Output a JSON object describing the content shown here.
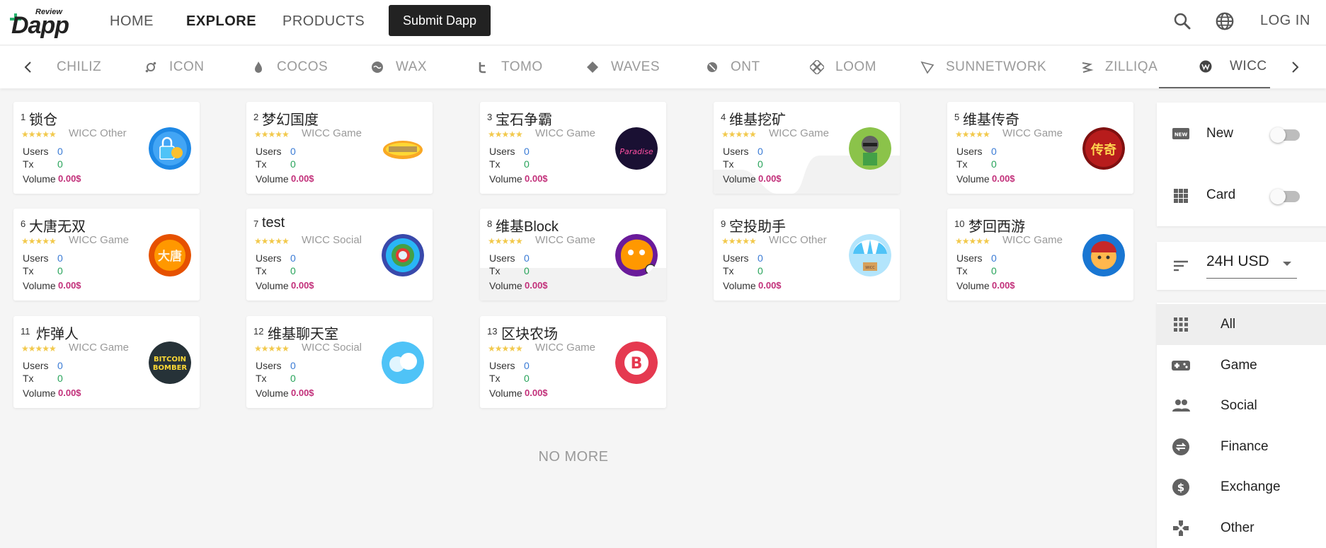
{
  "header": {
    "logo_review": "Review",
    "logo_dapp": "Dapp",
    "nav": [
      "HOME",
      "EXPLORE",
      "PRODUCTS"
    ],
    "submit_label": "Submit Dapp",
    "login_label": "LOG IN"
  },
  "chains": {
    "items": [
      {
        "label": "CHILIZ",
        "icon": "none"
      },
      {
        "label": "ICON",
        "icon": "icon-chain-icon"
      },
      {
        "label": "COCOS",
        "icon": "cocos-flame-icon"
      },
      {
        "label": "WAX",
        "icon": "wax-icon"
      },
      {
        "label": "TOMO",
        "icon": "tomo-icon"
      },
      {
        "label": "WAVES",
        "icon": "waves-diamond-icon"
      },
      {
        "label": "ONT",
        "icon": "ont-icon"
      },
      {
        "label": "LOOM",
        "icon": "loom-icon"
      },
      {
        "label": "SUNNETWORK",
        "icon": "sunnetwork-icon"
      },
      {
        "label": "ZILLIQA",
        "icon": "zilliqa-icon"
      },
      {
        "label": "WICC",
        "icon": "wicc-icon"
      }
    ],
    "active": "WICC"
  },
  "labels": {
    "users": "Users",
    "tx": "Tx",
    "volume": "Volume",
    "stars": "★★★★★"
  },
  "dapps": [
    {
      "rank": "1",
      "name": "锁仓",
      "category": "WICC Other",
      "users": "0",
      "tx": "0",
      "volume": "0.00$",
      "logo": "lock-logo"
    },
    {
      "rank": "2",
      "name": "梦幻国度",
      "category": "WICC Game",
      "users": "0",
      "tx": "0",
      "volume": "0.00$",
      "logo": "dream-kingdom-logo"
    },
    {
      "rank": "3",
      "name": "宝石争霸",
      "category": "WICC Game",
      "users": "0",
      "tx": "0",
      "volume": "0.00$",
      "logo": "gem-paradise-logo"
    },
    {
      "rank": "4",
      "name": "维基挖矿",
      "category": "WICC Game",
      "users": "0",
      "tx": "0",
      "volume": "0.00$",
      "logo": "mining-logo"
    },
    {
      "rank": "5",
      "name": "维基传奇",
      "category": "WICC Game",
      "users": "0",
      "tx": "0",
      "volume": "0.00$",
      "logo": "legend-logo"
    },
    {
      "rank": "6",
      "name": "大唐无双",
      "category": "WICC Game",
      "users": "0",
      "tx": "0",
      "volume": "0.00$",
      "logo": "datang-logo"
    },
    {
      "rank": "7",
      "name": "test",
      "category": "WICC Social",
      "users": "0",
      "tx": "0",
      "volume": "0.00$",
      "logo": "test-logo"
    },
    {
      "rank": "8",
      "name": "维基Block",
      "category": "WICC Game",
      "users": "0",
      "tx": "0",
      "volume": "0.00$",
      "logo": "block-logo"
    },
    {
      "rank": "9",
      "name": "空投助手",
      "category": "WICC Other",
      "users": "0",
      "tx": "0",
      "volume": "0.00$",
      "logo": "airdrop-logo"
    },
    {
      "rank": "10",
      "name": "梦回西游",
      "category": "WICC Game",
      "users": "0",
      "tx": "0",
      "volume": "0.00$",
      "logo": "journey-west-logo"
    },
    {
      "rank": "11",
      "name": "炸弹人",
      "category": "WICC Game",
      "users": "0",
      "tx": "0",
      "volume": "0.00$",
      "logo": "bitcoin-bomber-logo"
    },
    {
      "rank": "12",
      "name": "维基聊天室",
      "category": "WICC Social",
      "users": "0",
      "tx": "0",
      "volume": "0.00$",
      "logo": "chatroom-logo"
    },
    {
      "rank": "13",
      "name": "区块农场",
      "category": "WICC Game",
      "users": "0",
      "tx": "0",
      "volume": "0.00$",
      "logo": "block-farm-logo"
    }
  ],
  "logo_text": {
    "gem_paradise": "Paradise",
    "bitcoin_bomber_1": "BITCOIN",
    "bitcoin_bomber_2": "BOMBER",
    "legend_char": "传奇",
    "datang_char": "大唐",
    "farm_char": "B",
    "airdrop_crate": "WICC"
  },
  "no_more": "NO MORE",
  "sidebar": {
    "toggles": [
      {
        "label": "New",
        "icon": "new-badge-icon",
        "on": false
      },
      {
        "label": "Card",
        "icon": "grid-view-icon",
        "on": false
      }
    ],
    "sort": {
      "label": "24H USD",
      "icon": "sort-icon"
    },
    "categories": [
      {
        "label": "All",
        "icon": "apps-grid-icon",
        "active": true
      },
      {
        "label": "Game",
        "icon": "gamepad-icon",
        "active": false
      },
      {
        "label": "Social",
        "icon": "people-icon",
        "active": false
      },
      {
        "label": "Finance",
        "icon": "swap-circle-icon",
        "active": false
      },
      {
        "label": "Exchange",
        "icon": "dollar-circle-icon",
        "active": false
      },
      {
        "label": "Other",
        "icon": "other-icon",
        "active": false
      }
    ]
  },
  "colors": {
    "users": "#3a7bd5",
    "tx": "#27a35a",
    "volume": "#c2307a",
    "stars": "#f2c94c",
    "brand_green": "#27b46e"
  }
}
